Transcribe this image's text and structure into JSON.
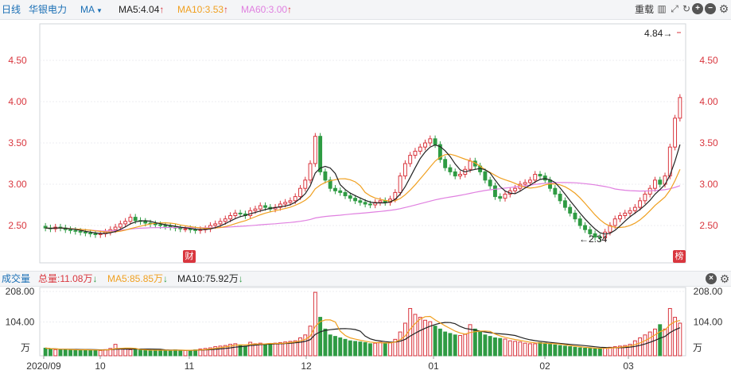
{
  "toolbar": {
    "period": "日线",
    "stock_name": "华银电力",
    "ma_menu": "MA",
    "ma5": "MA5:4.04",
    "ma10": "MA10:3.53",
    "ma60": "MA60:3.00",
    "rehab": "重载"
  },
  "price_axis": {
    "labels": [
      "4.50",
      "4.00",
      "3.50",
      "3.00",
      "2.50"
    ]
  },
  "annotations": {
    "high": "4.84→",
    "low": "←2.34",
    "fin_badge": "财",
    "rank_badge": "榜"
  },
  "volume_bar": {
    "title": "成交量",
    "total": "总量:11.08万",
    "ma5": "MA5:85.85万",
    "ma10": "MA10:75.92万"
  },
  "volume_axis": {
    "labels": [
      "208.00",
      "104.00"
    ],
    "unit": "万"
  },
  "date_axis": {
    "labels": [
      "2020/09",
      "10",
      "11",
      "12",
      "01",
      "02",
      "03"
    ]
  },
  "colors": {
    "up": "#d9363e",
    "down": "#2e9b43",
    "ma5": "#222222",
    "ma10": "#f0a020",
    "ma60": "#e080e0",
    "axis_text": "#d9363e",
    "accent": "#1a6fb5"
  },
  "chart_data": {
    "type": "candlestick",
    "series": [
      {
        "name": "MA5"
      },
      {
        "name": "MA10"
      },
      {
        "name": "MA60"
      }
    ],
    "close": [
      2.47,
      2.46,
      2.48,
      2.47,
      2.45,
      2.44,
      2.43,
      2.42,
      2.41,
      2.4,
      2.39,
      2.4,
      2.42,
      2.45,
      2.48,
      2.52,
      2.55,
      2.6,
      2.56,
      2.55,
      2.53,
      2.52,
      2.51,
      2.5,
      2.49,
      2.48,
      2.47,
      2.46,
      2.46,
      2.45,
      2.44,
      2.45,
      2.46,
      2.5,
      2.52,
      2.55,
      2.58,
      2.62,
      2.65,
      2.64,
      2.62,
      2.68,
      2.7,
      2.74,
      2.72,
      2.7,
      2.72,
      2.76,
      2.78,
      2.8,
      2.85,
      2.95,
      3.05,
      3.25,
      3.58,
      3.15,
      3.05,
      2.95,
      2.92,
      2.9,
      2.86,
      2.83,
      2.8,
      2.78,
      2.76,
      2.75,
      2.78,
      2.8,
      2.78,
      2.82,
      2.9,
      3.1,
      3.25,
      3.35,
      3.4,
      3.45,
      3.5,
      3.55,
      3.48,
      3.3,
      3.2,
      3.15,
      3.1,
      3.12,
      3.18,
      3.28,
      3.22,
      3.15,
      3.05,
      2.98,
      2.85,
      2.83,
      2.88,
      2.92,
      2.95,
      3.0,
      3.02,
      3.05,
      3.12,
      3.1,
      3.05,
      2.95,
      2.88,
      2.8,
      2.72,
      2.65,
      2.58,
      2.5,
      2.45,
      2.4,
      2.36,
      2.35,
      2.42,
      2.5,
      2.58,
      2.62,
      2.65,
      2.68,
      2.72,
      2.8,
      2.88,
      2.95,
      3.05,
      3.0,
      3.1,
      3.45,
      3.8,
      4.05
    ],
    "volume_wan": [
      15,
      12,
      10,
      9,
      11,
      10,
      9,
      8,
      10,
      9,
      8,
      7,
      10,
      14,
      28,
      12,
      12,
      10,
      9,
      8,
      8,
      7,
      9,
      8,
      8,
      7,
      9,
      8,
      7,
      8,
      9,
      12,
      14,
      16,
      20,
      22,
      24,
      28,
      30,
      26,
      22,
      35,
      30,
      32,
      28,
      30,
      32,
      34,
      36,
      38,
      40,
      50,
      60,
      90,
      205,
      120,
      80,
      60,
      55,
      50,
      45,
      40,
      38,
      36,
      34,
      30,
      32,
      35,
      33,
      34,
      45,
      70,
      100,
      150,
      130,
      120,
      110,
      105,
      90,
      80,
      70,
      65,
      60,
      58,
      62,
      95,
      80,
      70,
      60,
      55,
      50,
      48,
      46,
      40,
      38,
      36,
      32,
      30,
      30,
      34,
      32,
      28,
      26,
      24,
      22,
      20,
      18,
      16,
      15,
      14,
      13,
      14,
      16,
      18,
      20,
      22,
      24,
      28,
      40,
      50,
      60,
      70,
      80,
      95,
      80,
      150,
      120,
      100
    ]
  }
}
